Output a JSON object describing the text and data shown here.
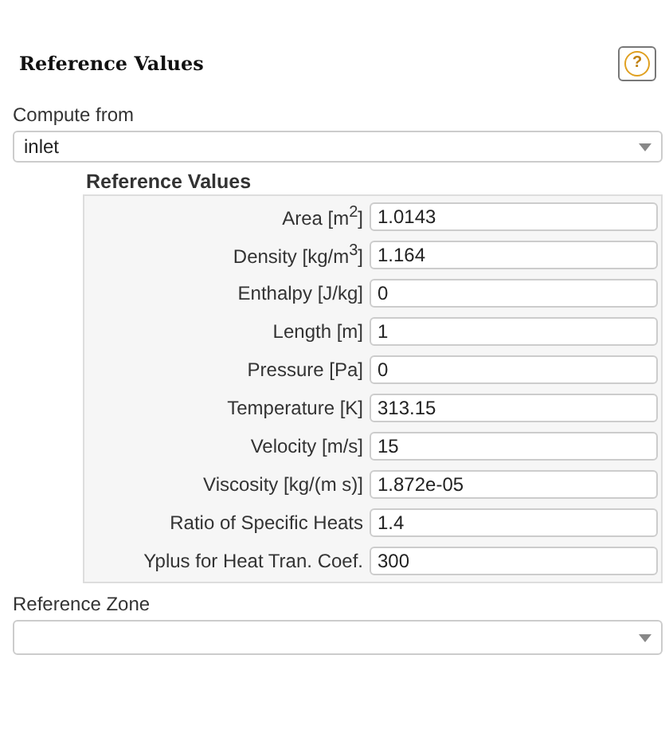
{
  "panel": {
    "title": "Reference Values",
    "help": "?"
  },
  "compute_from": {
    "label": "Compute from",
    "value": "inlet"
  },
  "group": {
    "title": "Reference Values",
    "fields": [
      {
        "label": "Area [m$^{2}$]",
        "value": "1.0143"
      },
      {
        "label": "Density [kg/m$^{3}$]",
        "value": "1.164"
      },
      {
        "label": "Enthalpy [J/kg]",
        "value": "0"
      },
      {
        "label": "Length [m]",
        "value": "1"
      },
      {
        "label": "Pressure [Pa]",
        "value": "0"
      },
      {
        "label": "Temperature [K]",
        "value": "313.15"
      },
      {
        "label": "Velocity [m/s]",
        "value": "15"
      },
      {
        "label": "Viscosity [kg/(m s)]",
        "value": "1.872e-05"
      },
      {
        "label": "Ratio of Specific Heats",
        "value": "1.4"
      },
      {
        "label": "Yplus for Heat Tran. Coef.",
        "value": "300"
      }
    ]
  },
  "reference_zone": {
    "label": "Reference Zone"
  }
}
